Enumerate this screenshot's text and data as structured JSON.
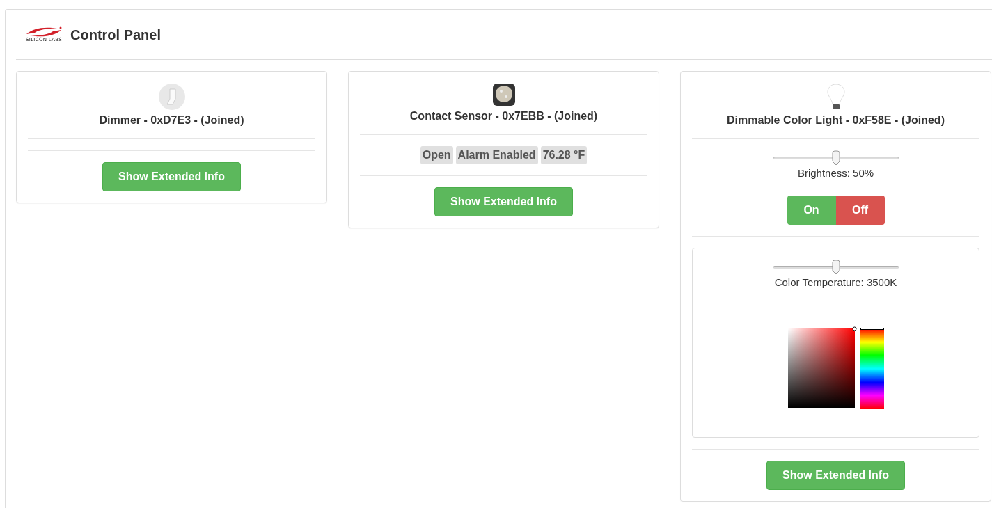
{
  "header": {
    "logo_text": "SILICON LABS",
    "title": "Control Panel"
  },
  "devices": [
    {
      "kind": "dimmer",
      "title": "Dimmer - 0xD7E3 - (Joined)",
      "button": "Show Extended Info"
    },
    {
      "kind": "sensor",
      "title": "Contact Sensor - 0x7EBB - (Joined)",
      "tags": [
        "Open",
        "Alarm Enabled",
        "76.28 °F"
      ],
      "button": "Show Extended Info"
    },
    {
      "kind": "light",
      "title": "Dimmable Color Light - 0xF58E - (Joined)",
      "brightness": {
        "level": 0.5,
        "label": "Brightness: 50%"
      },
      "switch": [
        "On",
        "Off"
      ],
      "temperature": {
        "level": 0.5,
        "label": "Color Temperature: 3500K"
      },
      "button": "Show Extended Info"
    }
  ]
}
